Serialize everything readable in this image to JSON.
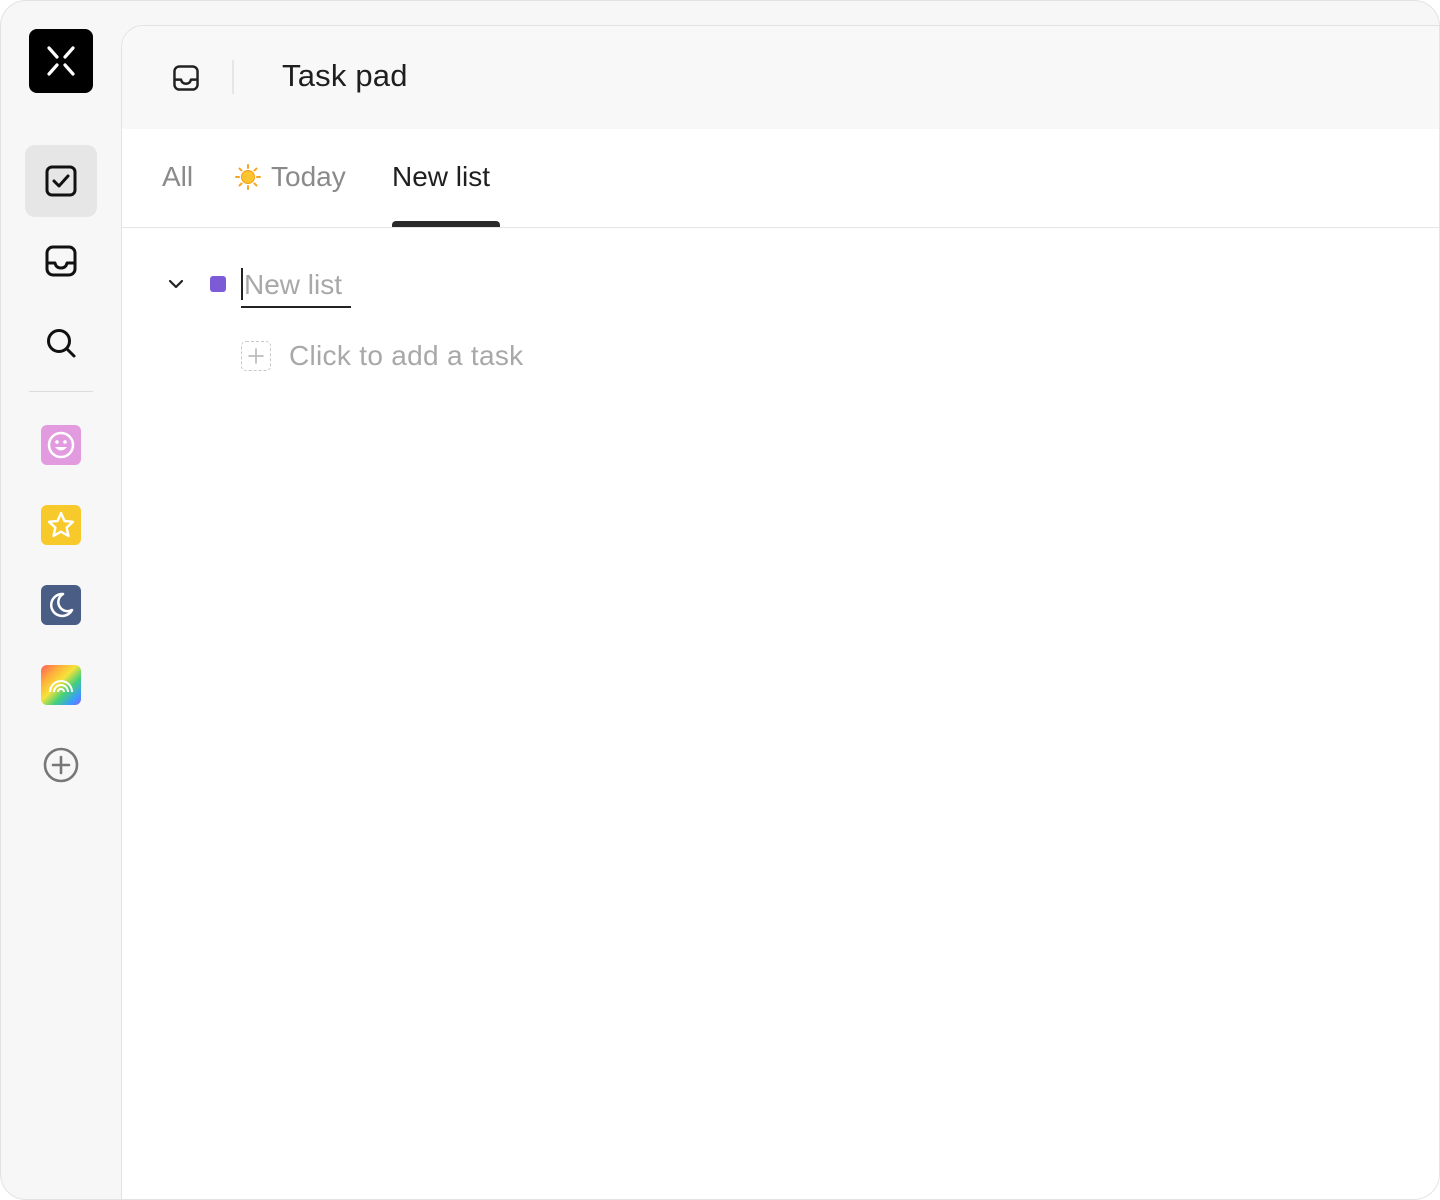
{
  "app": {
    "logo_icon": "app-logo-icon"
  },
  "sidebar": {
    "nav": [
      {
        "icon": "checkbox-icon",
        "active": true
      },
      {
        "icon": "inbox-icon",
        "active": false
      },
      {
        "icon": "search-icon",
        "active": false
      }
    ],
    "lists": [
      {
        "icon": "smiley-icon",
        "color": "#e39be0"
      },
      {
        "icon": "star-icon",
        "color": "#f7c92a"
      },
      {
        "icon": "moon-icon",
        "color": "#4a5e85"
      },
      {
        "icon": "rainbow-icon",
        "color": "gradient"
      }
    ],
    "add_icon": "plus-circle-icon"
  },
  "header": {
    "icon": "inbox-icon",
    "title": "Task pad"
  },
  "tabs": [
    {
      "label": "All",
      "active": false
    },
    {
      "label": "Today",
      "icon": "sun-icon",
      "active": false
    },
    {
      "label": "New list",
      "active": true
    }
  ],
  "list": {
    "name_placeholder": "New list",
    "name_value": "",
    "color": "#7d5bd6",
    "add_task_label": "Click to add a task"
  },
  "colors": {
    "accent": "#222222",
    "muted_text": "#a8a8a8"
  }
}
